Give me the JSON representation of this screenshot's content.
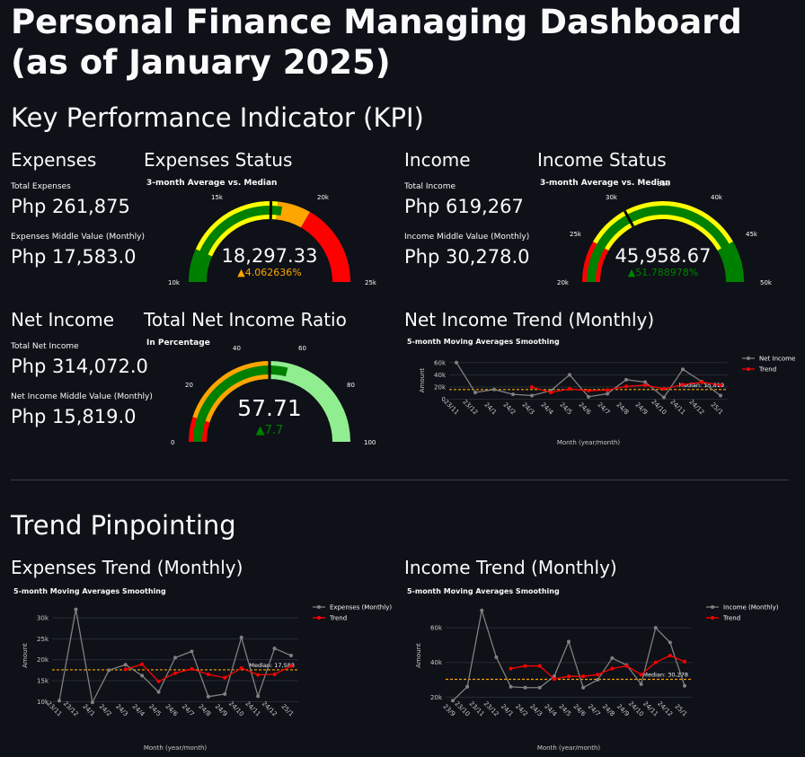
{
  "page": {
    "title": "Personal Finance Managing Dashboard (as of January 2025)",
    "kpi_heading": "Key Performance Indicator (KPI)",
    "trend_heading": "Trend Pinpointing"
  },
  "expenses": {
    "heading": "Expenses",
    "total_label": "Total Expenses",
    "total_value": "Php 261,875",
    "middle_label": "Expenses Middle Value (Monthly)",
    "middle_value": "Php 17,583.0"
  },
  "income": {
    "heading": "Income",
    "total_label": "Total Income",
    "total_value": "Php 619,267",
    "middle_label": "Income Middle Value (Monthly)",
    "middle_value": "Php 30,278.0"
  },
  "net_income": {
    "heading": "Net Income",
    "total_label": "Total Net Income",
    "total_value": "Php 314,072.0",
    "middle_label": "Net Income Middle Value (Monthly)",
    "middle_value": "Php 15,819.0"
  },
  "gauges": {
    "expenses": {
      "heading": "Expenses Status",
      "subtitle": "3-month Average vs. Median",
      "value": "18,297.33",
      "delta": "▲4.062636%",
      "delta_color": "#ffa500",
      "ticks": [
        "10k",
        "15k",
        "20k",
        "25k"
      ]
    },
    "income": {
      "heading": "Income Status",
      "subtitle": "3-month Average vs. Median",
      "value": "45,958.67",
      "delta": "▲51.788978%",
      "delta_color": "#008000",
      "ticks": [
        "20k",
        "25k",
        "30k",
        "35k",
        "40k",
        "45k",
        "50k"
      ]
    },
    "net": {
      "heading": "Total Net Income Ratio",
      "subtitle": "In Percentage",
      "value": "57.71",
      "delta": "▲7.7",
      "delta_color": "#008000",
      "ticks": [
        "0",
        "20",
        "40",
        "60",
        "80",
        "100"
      ]
    }
  },
  "chart_data": [
    {
      "type": "gauge",
      "title": "Expenses Status",
      "subtitle": "3-month Average vs. Median",
      "range": [
        10000,
        25000
      ],
      "value": 18297.33,
      "reference": 17583,
      "bands": [
        {
          "from": 10000,
          "to": 12000,
          "color": "#008000"
        },
        {
          "from": 12000,
          "to": 18000,
          "color": "#ffff00"
        },
        {
          "from": 18000,
          "to": 20000,
          "color": "#ffa500"
        },
        {
          "from": 20000,
          "to": 25000,
          "color": "#ff0000"
        }
      ],
      "bar_color": "#008000"
    },
    {
      "type": "gauge",
      "title": "Income Status",
      "subtitle": "3-month Average vs. Median",
      "range": [
        20000,
        50000
      ],
      "value": 45958.67,
      "reference": 30278,
      "bands": [
        {
          "from": 20000,
          "to": 25000,
          "color": "#ff0000"
        },
        {
          "from": 25000,
          "to": 45000,
          "color": "#ffff00"
        },
        {
          "from": 45000,
          "to": 50000,
          "color": "#008000"
        }
      ],
      "bar_color": "#008000"
    },
    {
      "type": "gauge",
      "title": "Total Net Income Ratio",
      "subtitle": "In Percentage",
      "range": [
        0,
        100
      ],
      "value": 57.71,
      "reference": 50,
      "bands": [
        {
          "from": 0,
          "to": 10,
          "color": "#ff0000"
        },
        {
          "from": 10,
          "to": 50,
          "color": "#ffa500"
        },
        {
          "from": 50,
          "to": 100,
          "color": "#90ee90"
        }
      ],
      "bar_color": "#008000"
    },
    {
      "type": "line",
      "title": "Net Income Trend (Monthly)",
      "subtitle": "5-month Moving Averages Smoothing",
      "xlabel": "Month (year/month)",
      "ylabel": "Amount",
      "ylim": [
        -8000,
        70000
      ],
      "yticks": [
        "0",
        "20k",
        "40k",
        "60k"
      ],
      "ytick_values": [
        0,
        20000,
        40000,
        60000
      ],
      "categories": [
        "23/11",
        "23/12",
        "24/1",
        "24/2",
        "24/3",
        "24/4",
        "24/5",
        "24/6",
        "24/7",
        "24/8",
        "24/9",
        "24/10",
        "24/11",
        "24/12",
        "25/1"
      ],
      "series": [
        {
          "name": "Net Income",
          "color": "#808080",
          "values": [
            60000,
            11000,
            16000,
            8000,
            6000,
            14000,
            40000,
            4000,
            9000,
            32000,
            28000,
            3000,
            49000,
            29000,
            6000
          ]
        },
        {
          "name": "Trend",
          "color": "#ff0000",
          "values": [
            null,
            null,
            null,
            null,
            20000,
            11000,
            17000,
            14000,
            15000,
            21000,
            23000,
            17000,
            24000,
            28000,
            23000
          ]
        }
      ],
      "median": 15819,
      "median_label": "Median: 15,819"
    },
    {
      "type": "line",
      "title": "Expenses Trend (Monthly)",
      "subtitle": "5-month Moving Averages Smoothing",
      "xlabel": "Month (year/month)",
      "ylabel": "Amount",
      "ylim": [
        9000,
        33000
      ],
      "yticks": [
        "10k",
        "15k",
        "20k",
        "25k",
        "30k"
      ],
      "ytick_values": [
        10000,
        15000,
        20000,
        25000,
        30000
      ],
      "categories": [
        "23/11",
        "23/12",
        "24/1",
        "24/2",
        "24/3",
        "24/4",
        "24/5",
        "24/6",
        "24/7",
        "24/8",
        "24/9",
        "24/10",
        "24/11",
        "24/12",
        "25/1"
      ],
      "series": [
        {
          "name": "Expenses (Monthly)",
          "color": "#808080",
          "values": [
            10200,
            32000,
            9800,
            17500,
            18800,
            16200,
            12300,
            20500,
            22000,
            11200,
            11800,
            25300,
            11300,
            22700,
            21000
          ]
        },
        {
          "name": "Trend",
          "color": "#ff0000",
          "values": [
            null,
            null,
            null,
            null,
            17700,
            18900,
            14800,
            16800,
            17800,
            16500,
            15700,
            18000,
            16400,
            16500,
            18500
          ]
        }
      ],
      "median": 17583,
      "median_label": "Median: 17,583"
    },
    {
      "type": "line",
      "title": "Income Trend (Monthly)",
      "subtitle": "5-month Moving Averages Smoothing",
      "xlabel": "Month (year/month)",
      "ylabel": "Amount",
      "ylim": [
        15000,
        73000
      ],
      "yticks": [
        "20k",
        "40k",
        "60k"
      ],
      "ytick_values": [
        20000,
        40000,
        60000
      ],
      "categories": [
        "23/9",
        "23/10",
        "23/11",
        "23/12",
        "24/1",
        "24/2",
        "24/3",
        "24/4",
        "24/5",
        "24/6",
        "24/7",
        "24/8",
        "24/9",
        "24/10",
        "24/11",
        "24/12",
        "25/1"
      ],
      "series": [
        {
          "name": "Income (Monthly)",
          "color": "#808080",
          "values": [
            18000,
            26000,
            70000,
            43000,
            26000,
            25500,
            25500,
            32000,
            52000,
            25500,
            30000,
            42500,
            38500,
            27500,
            60000,
            51500,
            26500
          ]
        },
        {
          "name": "Trend",
          "color": "#ff0000",
          "values": [
            null,
            null,
            null,
            null,
            36500,
            38000,
            38000,
            30500,
            32000,
            32000,
            33000,
            36500,
            38000,
            33000,
            40000,
            44000,
            40500
          ]
        }
      ],
      "median": 30278,
      "median_label": "Median: 30,278"
    }
  ]
}
